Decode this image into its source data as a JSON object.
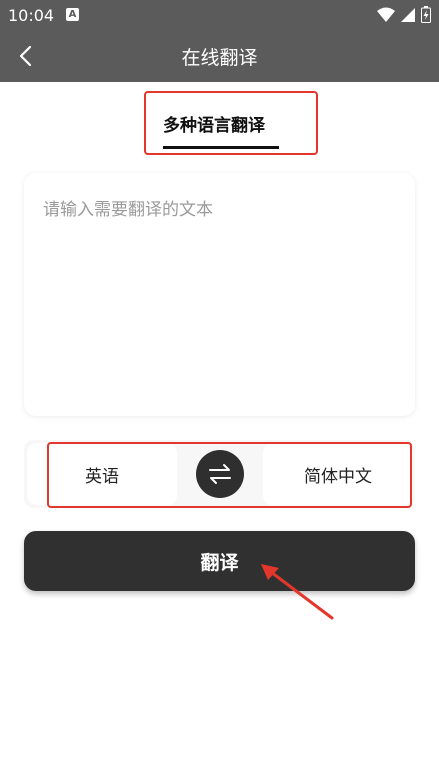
{
  "status_bar": {
    "time": "10:04",
    "notification_glyph": "A",
    "icons": [
      "wifi-icon",
      "signal-icon",
      "battery-icon"
    ]
  },
  "title_bar": {
    "title": "在线翻译",
    "back_icon": "chevron-left-icon"
  },
  "tabs": [
    {
      "label": "多种语言翻译",
      "active": true
    }
  ],
  "input": {
    "value": "",
    "placeholder": "请输入需要翻译的文本"
  },
  "languages": {
    "source": "英语",
    "target": "简体中文",
    "swap_icon": "swap-arrows-icon"
  },
  "translate_button": {
    "label": "翻译"
  },
  "colors": {
    "header_bg": "#5b5b5b",
    "button_bg": "#303030",
    "highlight_red": "#e4372b"
  }
}
